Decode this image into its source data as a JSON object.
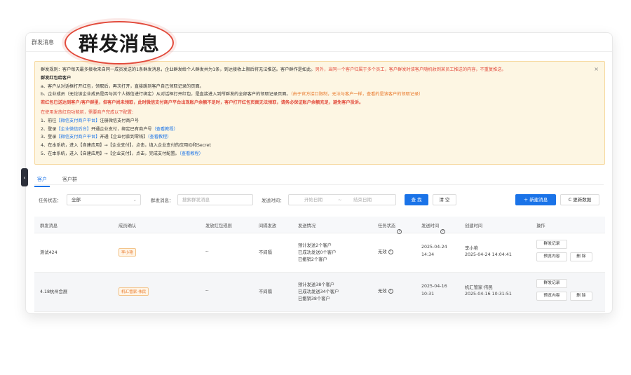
{
  "page": {
    "title": "群发消息",
    "stamp_text": "群发消息"
  },
  "notice": {
    "line1": "群发规则：客户每天最多接收来自同一成员发送的1条群发消息，企业群发给个人群发共为1条，到达接收上限后将无法推送。客户群作是如此。",
    "line1_red": "另外，当同一个客户归属于多个员工，客户群发时该客户随机收到某员工推送的内容，不重复推送。",
    "heading": "群发红包给客户",
    "a": "a、客户从对话框打开红包，领取后，再次打开，直接跳到客户自己领取记录的页面。",
    "b": "b、企业成员（无论该企业成员是否与其个人微信进行绑定）从对话框打开红包，是直接进入到所群发的全部客户的领取记录页面。",
    "b_orange": "（由于官方接口限制，无法与客户一样，查看的是该客户的领取记录）",
    "warn": "若红包已送达到客户/客户群里，但客户尚未领取，此时微信支付商户平台出现账户余额不足时，客户打开红包页面无法领取，请务必保证账户余额充足，避免客户投诉。",
    "config_intro": "在使用发放红包功能前，需要商户完成以下配置：",
    "steps": [
      {
        "pre": "1、前往",
        "link": "【微信支付商户平台】",
        "post": "注册微信支付商户号",
        "doc": ""
      },
      {
        "pre": "2、登录",
        "link": "【企业微信后台】",
        "post": "开通企业支付，绑定已有商户号",
        "doc": "（查看教程）"
      },
      {
        "pre": "3、登录",
        "link": "【微信支付商户平台】",
        "post": "开通【企业付款到零钱】",
        "doc": "（查看教程）"
      },
      {
        "pre": "4、在本系统，进入【自建应用】→【企业支付】，点击，填入企业支付的应用ID和Secret",
        "link": "",
        "post": "",
        "doc": ""
      },
      {
        "pre": "5、在本系统，进入【自建应用】→【企业支付】，点击，完成支付配置。",
        "link": "",
        "post": "",
        "doc": "（查看教程）"
      }
    ],
    "close_icon": "×"
  },
  "tabs": [
    "客户",
    "客户群"
  ],
  "filters": {
    "status_label": "任务状态：",
    "status_value": "全部",
    "msg_label": "群发消息：",
    "msg_placeholder": "搜索群发消息",
    "time_label": "发送时间：",
    "start_placeholder": "开始日期",
    "range_sep": "~",
    "end_placeholder": "结束日期",
    "search_btn": "查 找",
    "clear_btn": "清 空",
    "new_btn": "＋ 新建消息",
    "refresh_btn": "C 更新数据"
  },
  "table": {
    "headers": [
      "群发消息",
      "成员确认",
      "发放红包规则",
      "间隔发放",
      "发送情况",
      "任务状态",
      "发送时间",
      "创建时间",
      "操作"
    ],
    "rows": [
      {
        "msg": "测试424",
        "member": "李小艳",
        "rule": "--",
        "interval": "不间隔",
        "sent1": "预计发送2个客户",
        "sent2": "已成功发送0个客户",
        "sent3": "已撤销2个客户",
        "status": "无效",
        "send_date": "2025-04-24",
        "send_time": "14:34",
        "creator": "李小艳",
        "created": "2025-04-24 14:04:41",
        "op1": "群发记录",
        "op2": "预览内容",
        "op3": "删 除"
      },
      {
        "msg": "4.18杭州会展",
        "member": "机汇管家·伟民",
        "rule": "--",
        "interval": "不间隔",
        "sent1": "预计发送38个客户",
        "sent2": "已成功发送34个客户",
        "sent3": "已撤销38个客户",
        "status": "无效",
        "send_date": "2025-04-16",
        "send_time": "10:31",
        "creator": "机汇管家·伟民",
        "created": "2025-04-16 10:31:51",
        "op1": "群发记录",
        "op2": "预览内容",
        "op3": "删 除"
      }
    ]
  }
}
